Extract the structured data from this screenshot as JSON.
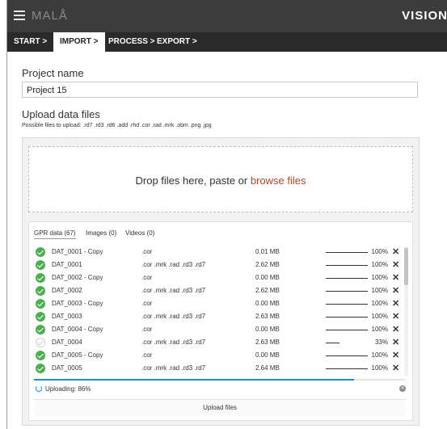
{
  "app": {
    "brand": "MALÅ",
    "product": "VISION"
  },
  "steps": [
    {
      "label": "START >"
    },
    {
      "label": "IMPORT >"
    },
    {
      "label": "PROCESS >"
    },
    {
      "label": "EXPORT >"
    }
  ],
  "project": {
    "label": "Project name",
    "value": "Project 15"
  },
  "upload": {
    "title": "Upload data files",
    "hint": "Possible files to upload: .rd7 .rd3 .rd6 .add .rhd .cor .rad .mrk .obm .png .jpg",
    "drop_text": "Drop files here, paste or ",
    "browse_label": "browse files"
  },
  "tabs": [
    {
      "label": "GPR data (67)"
    },
    {
      "label": "Images (0)"
    },
    {
      "label": "Videos (0)"
    }
  ],
  "files": [
    {
      "name": "DAT_0001 - Copy",
      "ext": ".cor",
      "size": "0.01 MB",
      "pct": "100%",
      "progress": 1.0,
      "done": true
    },
    {
      "name": "DAT_0001",
      "ext": ".cor .mrk .rad .rd3 .rd7",
      "size": "2.62 MB",
      "pct": "100%",
      "progress": 1.0,
      "done": true
    },
    {
      "name": "DAT_0002 - Copy",
      "ext": ".cor",
      "size": "0.00 MB",
      "pct": "100%",
      "progress": 1.0,
      "done": true
    },
    {
      "name": "DAT_0002",
      "ext": ".cor .mrk .rad .rd3 .rd7",
      "size": "2.62 MB",
      "pct": "100%",
      "progress": 1.0,
      "done": true
    },
    {
      "name": "DAT_0003 - Copy",
      "ext": ".cor",
      "size": "0.00 MB",
      "pct": "100%",
      "progress": 1.0,
      "done": true
    },
    {
      "name": "DAT_0003",
      "ext": ".cor .mrk .rad .rd3 .rd7",
      "size": "2.63 MB",
      "pct": "100%",
      "progress": 1.0,
      "done": true
    },
    {
      "name": "DAT_0004 - Copy",
      "ext": ".cor",
      "size": "0.00 MB",
      "pct": "100%",
      "progress": 1.0,
      "done": true
    },
    {
      "name": "DAT_0004",
      "ext": ".cor .mrk .rad .rd3 .rd7",
      "size": "2.63 MB",
      "pct": "33%",
      "progress": 0.33,
      "done": false
    },
    {
      "name": "DAT_0005 - Copy",
      "ext": ".cor",
      "size": "0.00 MB",
      "pct": "100%",
      "progress": 1.0,
      "done": true
    },
    {
      "name": "DAT_0005",
      "ext": ".cor .mrk .rad .rd3 .rd7",
      "size": "2.64 MB",
      "pct": "100%",
      "progress": 1.0,
      "done": true
    }
  ],
  "status": {
    "text": "Uploading: 86%",
    "progress": 0.86
  },
  "upload_button": {
    "label": "Upload files"
  },
  "icons": {
    "menu": "hamburger-icon",
    "done": "check-circle-icon",
    "remove": "close-icon",
    "cancel": "cancel-circle-icon",
    "busy": "spinner-icon"
  },
  "colors": {
    "appbar": "#3c3c3c",
    "stepbar": "#2a2a2a",
    "accent_link": "#b4462a",
    "success": "#4caf50",
    "progress": "#1e88e5"
  }
}
